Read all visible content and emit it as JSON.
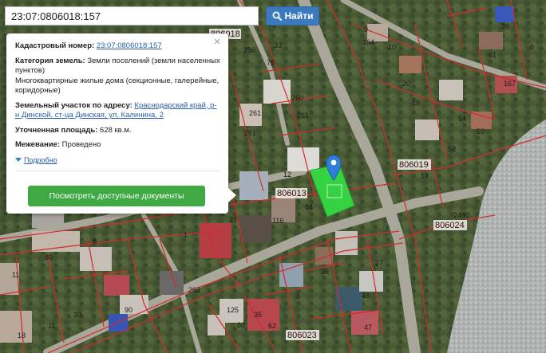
{
  "search": {
    "value": "23:07:0806018:157",
    "button_label": "Найти"
  },
  "popup": {
    "cadastral_label": "Кадастровый номер:",
    "cadastral_value": "23:07:0806018:157",
    "category_label": "Категория земель:",
    "category_value": "Земли поселений (земли населенных пунктов)",
    "usage_value": "Многоквартирные жилые дома (секционные, галерейные, коридорные)",
    "address_label": "Земельный участок по адресу:",
    "address_value": "Краснодарский край, р-н Динской, ст-ца Динская, ул. Калинина, 2",
    "area_label": "Уточненная площадь:",
    "area_value": "628 кв.м.",
    "survey_label": "Межевание:",
    "survey_value": "Проведено",
    "more_label": "Подробно",
    "docs_button": "Посмотреть доступные документы",
    "close": "×"
  },
  "map": {
    "parcel_labels": [
      "8",
      "71",
      "236",
      "33",
      "75",
      "36",
      "9",
      "164",
      "61",
      "6",
      "10",
      "167",
      "20",
      "260",
      "261",
      "19",
      "251",
      "261",
      "54",
      "59",
      "58",
      "17",
      "12",
      "84",
      "116",
      "27",
      "2460",
      "8",
      "11",
      "80",
      "36",
      "3",
      "48",
      "27",
      "90",
      "263",
      "125",
      "35",
      "62",
      "47",
      "20",
      "11",
      "1",
      "18",
      "80"
    ],
    "block_labels": [
      "806018",
      "806019",
      "806024",
      "806023",
      "806013"
    ],
    "colors": {
      "selected_parcel": "#33dd44",
      "parcel_border": "#d42a2a",
      "marker": "#2f7fd8"
    }
  }
}
